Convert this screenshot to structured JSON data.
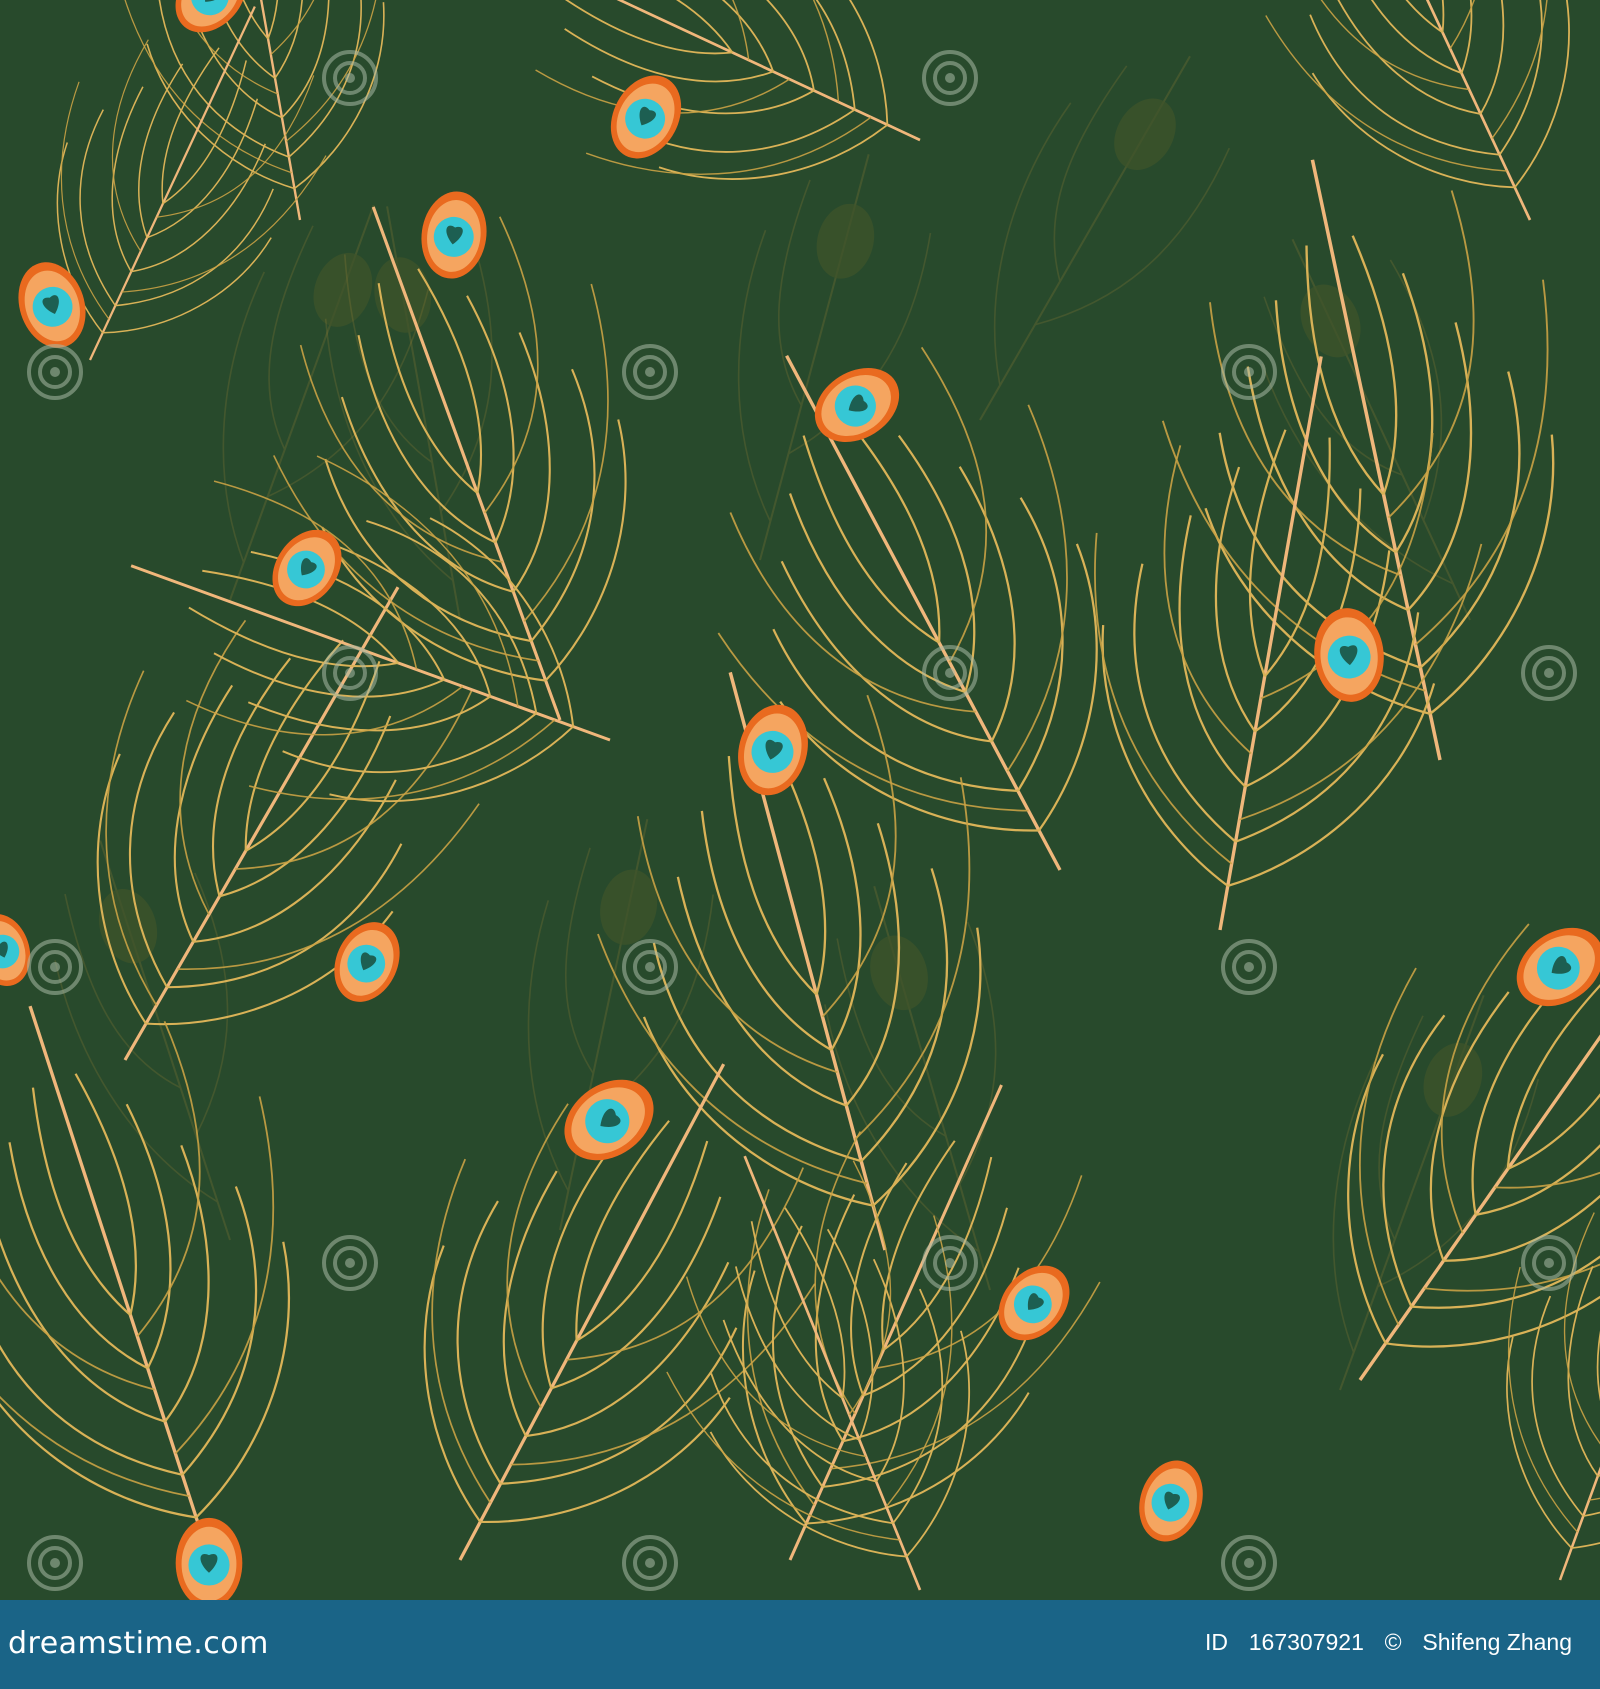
{
  "image": {
    "description_subject": "peacock-feathers-seamless-pattern",
    "background_color": "#284a2c",
    "feather_color": "#d9b257",
    "eye_orange": "#f08a2a",
    "eye_cyan": "#34c6d3",
    "eye_pale": "#f7b36a",
    "watermark_text": "dreamstime"
  },
  "footer": {
    "brand": "dreamstime.com",
    "id_label": "ID",
    "id_value": "167307921",
    "copyright_symbol": "©",
    "author": "Shifeng Zhang",
    "bar_color": "#1a6487"
  }
}
